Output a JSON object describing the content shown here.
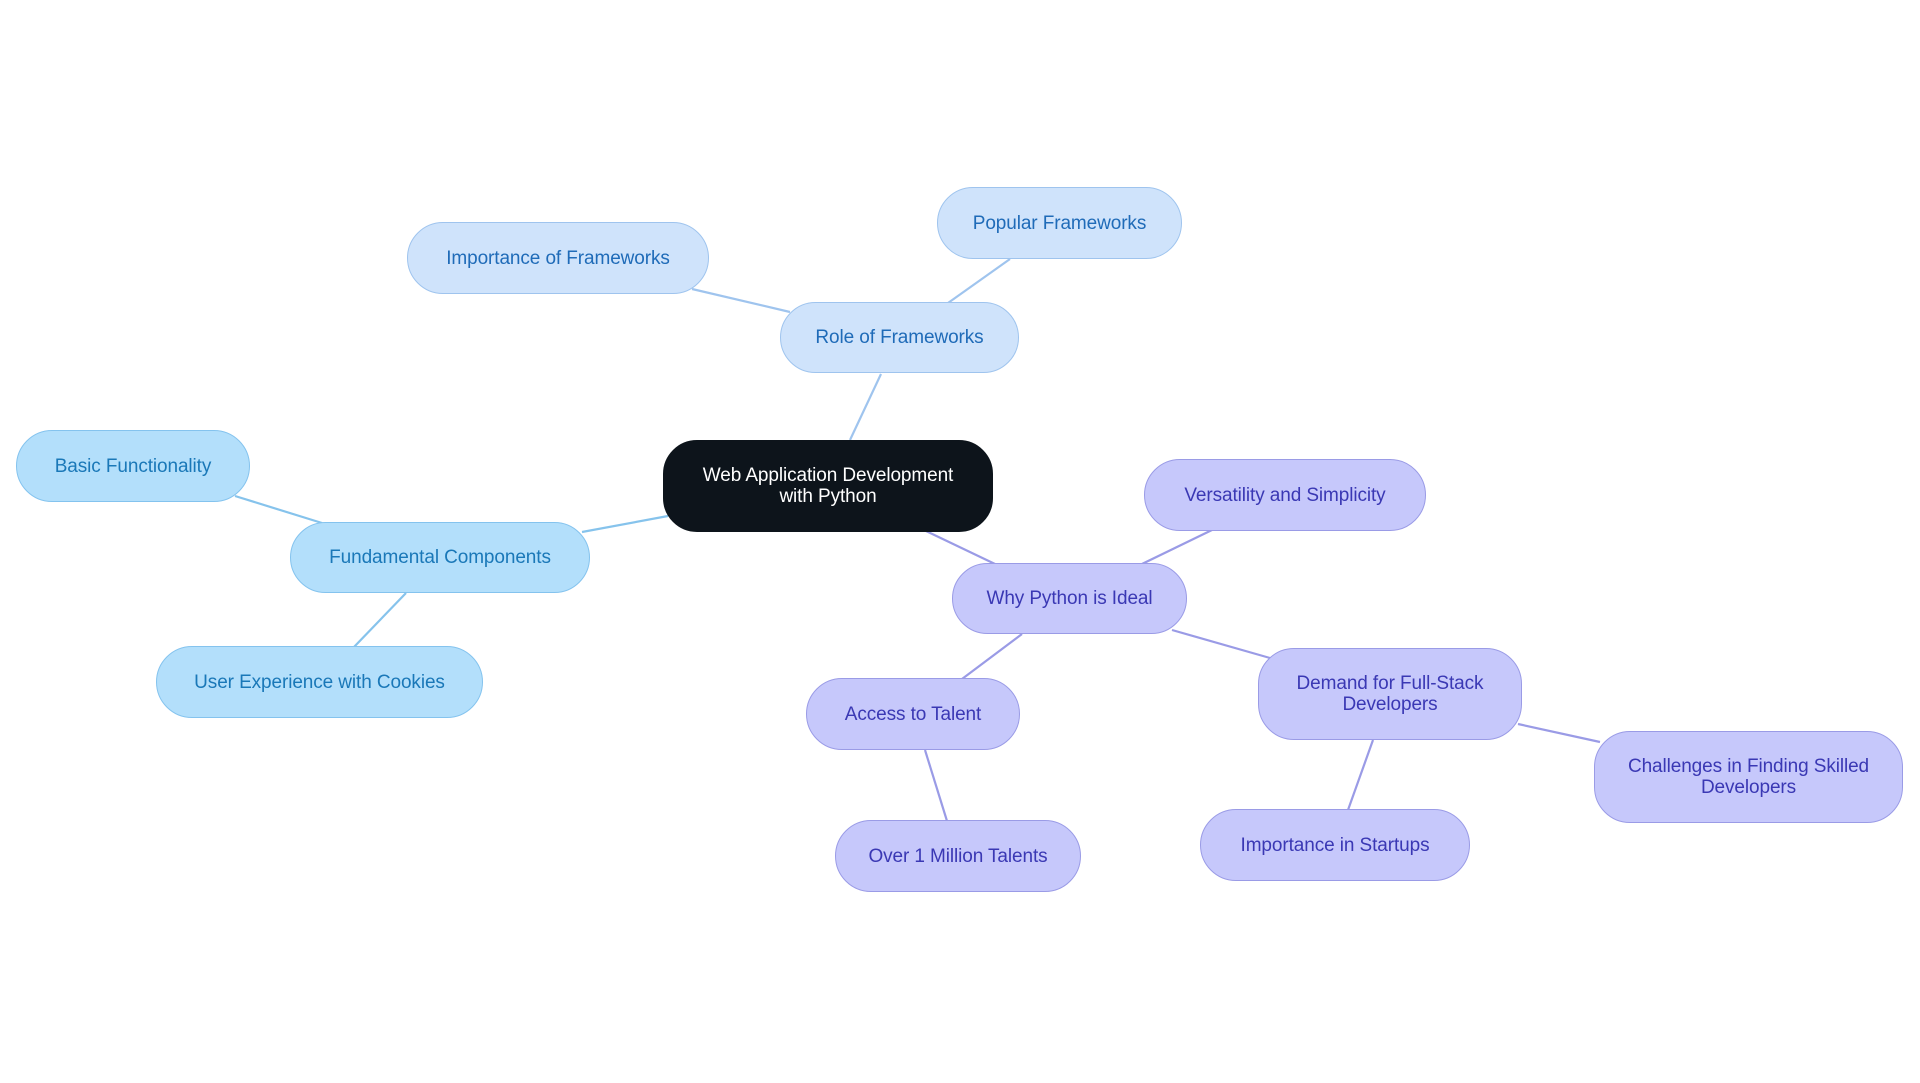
{
  "diagram": {
    "type": "mind-map",
    "colors": {
      "root_fill": "#0d141b",
      "root_text": "#ffffff",
      "frameworks_branch_fill": "#cfe3fb",
      "frameworks_branch_text": "#1f6bb8",
      "frameworks_branch_line": "#9fc4ee",
      "components_branch_fill": "#b3dffb",
      "components_branch_text": "#1a78b8",
      "components_branch_line": "#86c3ec",
      "python_branch_fill": "#c6c8fb",
      "python_branch_text": "#3a38b4",
      "python_branch_line": "#9a9be6"
    },
    "root": {
      "id": "root",
      "label": "Web Application Development with Python"
    },
    "nodes": [
      {
        "id": "role",
        "label": "Role of Frameworks",
        "parent": "root",
        "branch": "blue"
      },
      {
        "id": "importance_fw",
        "label": "Importance of Frameworks",
        "parent": "role",
        "branch": "blue"
      },
      {
        "id": "popular_fw",
        "label": "Popular Frameworks",
        "parent": "role",
        "branch": "blue"
      },
      {
        "id": "fundamental",
        "label": "Fundamental Components",
        "parent": "root",
        "branch": "cyan"
      },
      {
        "id": "basic",
        "label": "Basic Functionality",
        "parent": "fundamental",
        "branch": "cyan"
      },
      {
        "id": "cookies",
        "label": "User Experience with Cookies",
        "parent": "fundamental",
        "branch": "cyan"
      },
      {
        "id": "why",
        "label": "Why Python is Ideal",
        "parent": "root",
        "branch": "purple"
      },
      {
        "id": "versatility",
        "label": "Versatility and Simplicity",
        "parent": "why",
        "branch": "purple"
      },
      {
        "id": "demand",
        "label": "Demand for Full-Stack Developers",
        "parent": "why",
        "branch": "purple"
      },
      {
        "id": "access",
        "label": "Access to Talent",
        "parent": "why",
        "branch": "purple"
      },
      {
        "id": "million",
        "label": "Over 1 Million Talents",
        "parent": "access",
        "branch": "purple"
      },
      {
        "id": "startups",
        "label": "Importance in Startups",
        "parent": "demand",
        "branch": "purple"
      },
      {
        "id": "challenges",
        "label": "Challenges in Finding Skilled Developers",
        "parent": "demand",
        "branch": "purple"
      }
    ]
  },
  "labels": {
    "root_line1": "Web Application Development",
    "root_line2": "with Python",
    "role": "Role of Frameworks",
    "importance_fw": "Importance of Frameworks",
    "popular_fw": "Popular Frameworks",
    "fundamental": "Fundamental Components",
    "basic": "Basic Functionality",
    "cookies": "User Experience with Cookies",
    "why": "Why Python is Ideal",
    "versatility": "Versatility and Simplicity",
    "demand_line1": "Demand for Full-Stack",
    "demand_line2": "Developers",
    "access": "Access to Talent",
    "million": "Over 1 Million Talents",
    "startups": "Importance in Startups",
    "challenges_line1": "Challenges in Finding Skilled",
    "challenges_line2": "Developers"
  }
}
